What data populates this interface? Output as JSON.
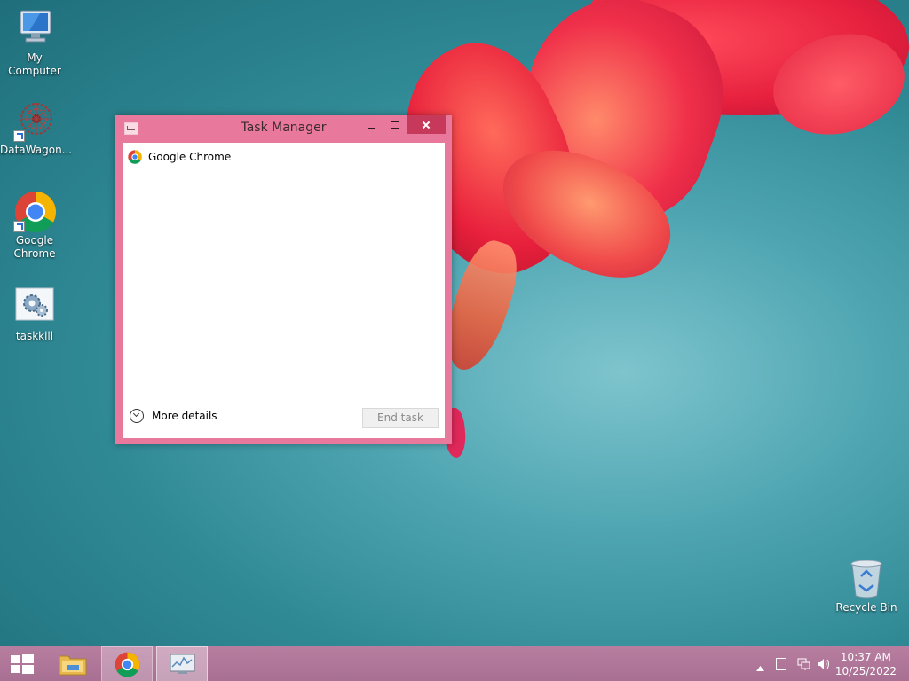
{
  "desktop": {
    "icons": [
      {
        "label": "My Computer",
        "icon": "computer-icon"
      },
      {
        "label": "DataWagon...",
        "icon": "datawagon-icon"
      },
      {
        "label": "Google Chrome",
        "icon": "chrome-icon"
      },
      {
        "label": "taskkill",
        "icon": "taskkill-icon"
      }
    ],
    "recycle_bin": {
      "label": "Recycle Bin",
      "icon": "recycle-bin-icon"
    }
  },
  "task_manager": {
    "title": "Task Manager",
    "processes": [
      {
        "name": "Google Chrome",
        "icon": "chrome-icon"
      }
    ],
    "more_details_label": "More details",
    "end_task_label": "End task"
  },
  "taskbar": {
    "buttons": [
      {
        "name": "start",
        "icon": "windows-logo-icon"
      },
      {
        "name": "file-explorer",
        "icon": "folder-icon"
      },
      {
        "name": "google-chrome",
        "icon": "chrome-icon"
      },
      {
        "name": "task-manager",
        "icon": "task-manager-icon"
      }
    ],
    "tray": {
      "time": "10:37 AM",
      "date": "10/25/2022"
    }
  },
  "colors": {
    "window_frame": "#e9799c",
    "close_button": "#c7395a",
    "taskbar": "#b87ea0",
    "desktop_background": "#2f8995"
  }
}
